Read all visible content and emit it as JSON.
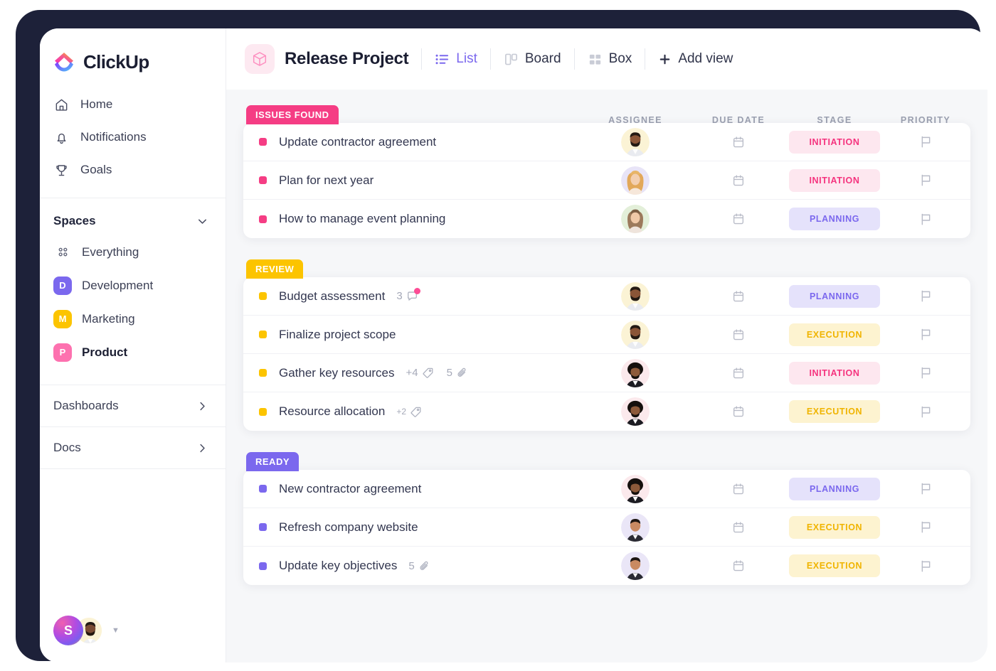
{
  "brand": {
    "name": "ClickUp",
    "logo_icon": "clickup-logo-icon"
  },
  "sidebar": {
    "nav": [
      {
        "label": "Home",
        "icon": "home-icon"
      },
      {
        "label": "Notifications",
        "icon": "bell-icon"
      },
      {
        "label": "Goals",
        "icon": "trophy-icon"
      }
    ],
    "spaces_section": {
      "title": "Spaces",
      "chevron_icon": "chevron-down-icon"
    },
    "spaces": [
      {
        "label": "Everything",
        "icon": "grid-dots-icon",
        "badge": "",
        "color": "",
        "bold": false
      },
      {
        "label": "Development",
        "icon": "space-badge",
        "badge": "D",
        "color": "#7b68ee",
        "bold": false
      },
      {
        "label": "Marketing",
        "icon": "space-badge",
        "badge": "M",
        "color": "#fcc400",
        "bold": false
      },
      {
        "label": "Product",
        "icon": "space-badge",
        "badge": "P",
        "color": "#fd71af",
        "bold": true
      }
    ],
    "footer_links": [
      {
        "label": "Dashboards",
        "icon": "chevron-right-icon"
      },
      {
        "label": "Docs",
        "icon": "chevron-right-icon"
      }
    ],
    "user": {
      "initial": "S",
      "avatar_icon": "user-avatar",
      "caret_icon": "caret-down-icon"
    }
  },
  "header": {
    "project_icon": "cube-icon",
    "project_title": "Release Project",
    "views": [
      {
        "label": "List",
        "icon": "list-view-icon",
        "active": true
      },
      {
        "label": "Board",
        "icon": "board-view-icon",
        "active": false
      },
      {
        "label": "Box",
        "icon": "box-view-icon",
        "active": false
      }
    ],
    "add_view": {
      "label": "Add view",
      "icon": "plus-icon"
    }
  },
  "columns": {
    "assignee": "ASSIGNEE",
    "due_date": "DUE DATE",
    "stage": "STAGE",
    "priority": "PRIORITY"
  },
  "groups": [
    {
      "label": "ISSUES FOUND",
      "color": "#f53d84",
      "bullet_color": "#f53d84",
      "tasks": [
        {
          "name": "Update contractor agreement",
          "comments": "",
          "tags": "",
          "attachments": "",
          "avatar_bg": "#fbf3d5",
          "avatar_type": "man-beard",
          "due_icon": "calendar-icon",
          "stage": "INITIATION",
          "stage_bg": "#fde7ef",
          "stage_color": "#f5337e",
          "priority_icon": "flag-icon"
        },
        {
          "name": "Plan for next year",
          "comments": "",
          "tags": "",
          "attachments": "",
          "avatar_bg": "#e8e4f7",
          "avatar_type": "woman-blonde",
          "due_icon": "calendar-icon",
          "stage": "INITIATION",
          "stage_bg": "#fde7ef",
          "stage_color": "#f5337e",
          "priority_icon": "flag-icon"
        },
        {
          "name": "How to manage event planning",
          "comments": "",
          "tags": "",
          "attachments": "",
          "avatar_bg": "#e3efd9",
          "avatar_type": "woman-brunette",
          "due_icon": "calendar-icon",
          "stage": "PLANNING",
          "stage_bg": "#e5e2fb",
          "stage_color": "#7b68ee",
          "priority_icon": "flag-icon"
        }
      ]
    },
    {
      "label": "REVIEW",
      "color": "#fcc400",
      "bullet_color": "#fcc400",
      "tasks": [
        {
          "name": "Budget assessment",
          "comments": "3",
          "tags": "",
          "attachments": "",
          "comment_unread": true,
          "avatar_bg": "#fbf3d5",
          "avatar_type": "man-beard",
          "due_icon": "calendar-icon",
          "stage": "PLANNING",
          "stage_bg": "#e5e2fb",
          "stage_color": "#7b68ee",
          "priority_icon": "flag-icon"
        },
        {
          "name": "Finalize project scope",
          "comments": "",
          "tags": "",
          "attachments": "",
          "avatar_bg": "#fbf3d5",
          "avatar_type": "man-beard",
          "due_icon": "calendar-icon",
          "stage": "EXECUTION",
          "stage_bg": "#fdf3d0",
          "stage_color": "#f0b400",
          "priority_icon": "flag-icon"
        },
        {
          "name": "Gather key resources",
          "comments": "",
          "tags": "+4",
          "attachments": "5",
          "avatar_bg": "#fbe9ec",
          "avatar_type": "man-afro",
          "due_icon": "calendar-icon",
          "stage": "INITIATION",
          "stage_bg": "#fde7ef",
          "stage_color": "#f5337e",
          "priority_icon": "flag-icon"
        },
        {
          "name": "Resource allocation",
          "comments": "",
          "tags": "+2",
          "attachments": "",
          "tags_small": true,
          "avatar_bg": "#fbe9ec",
          "avatar_type": "man-afro",
          "due_icon": "calendar-icon",
          "stage": "EXECUTION",
          "stage_bg": "#fdf3d0",
          "stage_color": "#f0b400",
          "priority_icon": "flag-icon"
        }
      ]
    },
    {
      "label": "READY",
      "color": "#7b68ee",
      "bullet_color": "#7b68ee",
      "tasks": [
        {
          "name": "New contractor agreement",
          "comments": "",
          "tags": "",
          "attachments": "",
          "avatar_bg": "#fbe9ec",
          "avatar_type": "man-afro",
          "due_icon": "calendar-icon",
          "stage": "PLANNING",
          "stage_bg": "#e5e2fb",
          "stage_color": "#7b68ee",
          "priority_icon": "flag-icon"
        },
        {
          "name": "Refresh company website",
          "comments": "",
          "tags": "",
          "attachments": "",
          "avatar_bg": "#eae6f7",
          "avatar_type": "man-short",
          "due_icon": "calendar-icon",
          "stage": "EXECUTION",
          "stage_bg": "#fdf3d0",
          "stage_color": "#f0b400",
          "priority_icon": "flag-icon"
        },
        {
          "name": "Update key objectives",
          "comments": "",
          "tags": "",
          "attachments": "5",
          "avatar_bg": "#eae6f7",
          "avatar_type": "man-short",
          "due_icon": "calendar-icon",
          "stage": "EXECUTION",
          "stage_bg": "#fdf3d0",
          "stage_color": "#f0b400",
          "priority_icon": "flag-icon"
        }
      ]
    }
  ]
}
